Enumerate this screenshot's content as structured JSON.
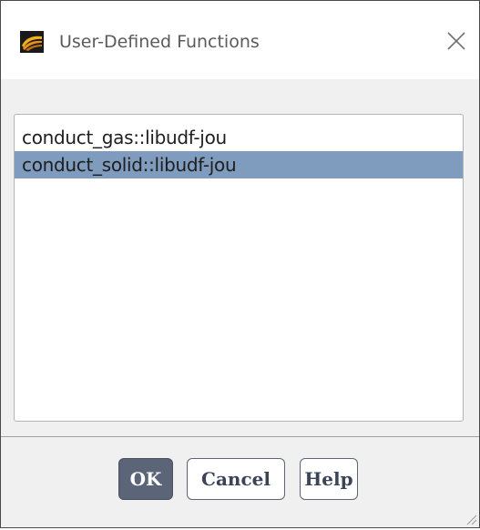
{
  "window": {
    "title": "User-Defined Functions",
    "icon": "ansys-fluent-icon",
    "close_icon": "close-icon"
  },
  "function_list": {
    "items": [
      {
        "label": "conduct_gas::libudf-jou",
        "selected": false
      },
      {
        "label": "conduct_solid::libudf-jou",
        "selected": true
      }
    ],
    "selection_color": "#7f9bbd"
  },
  "buttons": {
    "ok_label": "OK",
    "cancel_label": "Cancel",
    "help_label": "Help",
    "primary_color": "#5b6577"
  }
}
